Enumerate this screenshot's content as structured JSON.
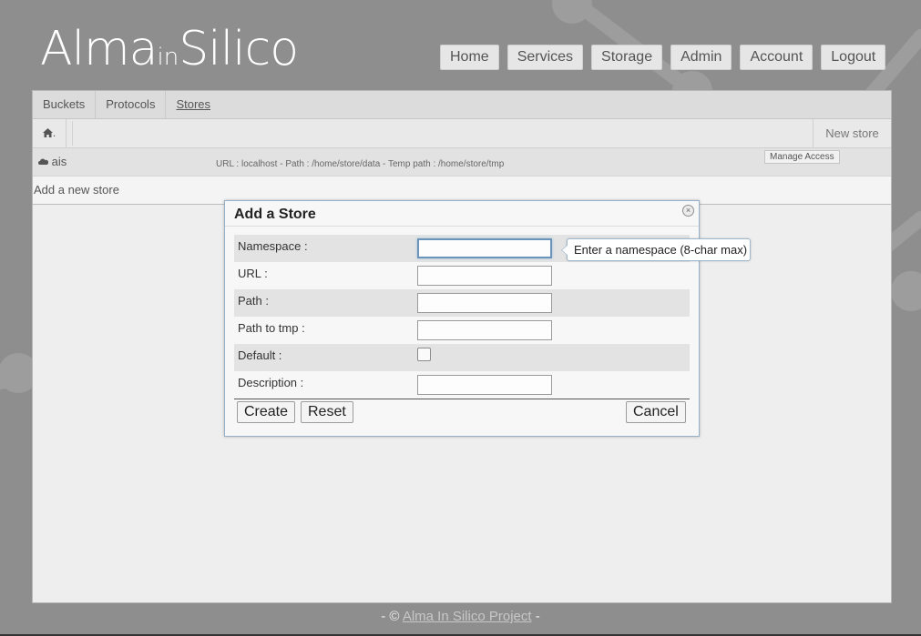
{
  "header": {
    "logo": {
      "part1": "Alma",
      "part2": "in",
      "part3": "Silico"
    },
    "nav": [
      "Home",
      "Services",
      "Storage",
      "Admin",
      "Account",
      "Logout"
    ]
  },
  "tabs": [
    {
      "label": "Buckets"
    },
    {
      "label": "Protocols"
    },
    {
      "label": "Stores",
      "active": true
    }
  ],
  "breadcrumb": {
    "home_icon": "home-icon",
    "home_suffix": "."
  },
  "actions": {
    "new_store": "New store"
  },
  "stores": [
    {
      "icon": "cloud-icon",
      "name": "ais",
      "info": "URL : localhost - Path : /home/store/data - Temp path : /home/store/tmp",
      "manage": "Manage Access"
    }
  ],
  "add_store_label": "Add a new store",
  "dialog": {
    "title": "Add a Store",
    "close_icon": "close-icon",
    "fields": {
      "namespace": {
        "label": "Namespace :",
        "value": ""
      },
      "url": {
        "label": "URL :",
        "value": ""
      },
      "path": {
        "label": "Path :",
        "value": ""
      },
      "tmp": {
        "label": "Path to tmp :",
        "value": ""
      },
      "default": {
        "label": "Default :",
        "checked": false
      },
      "description": {
        "label": "Description :",
        "value": ""
      }
    },
    "buttons": {
      "create": "Create",
      "reset": "Reset",
      "cancel": "Cancel"
    },
    "tooltip": "Enter a namespace (8-char max)"
  },
  "footer": {
    "prefix": "- ©",
    "link": "Alma In Silico Project",
    "suffix": "-"
  },
  "colors": {
    "background": "#8e8e8e",
    "panel": "#eeeeee",
    "dialog_border": "#97b2c8"
  }
}
